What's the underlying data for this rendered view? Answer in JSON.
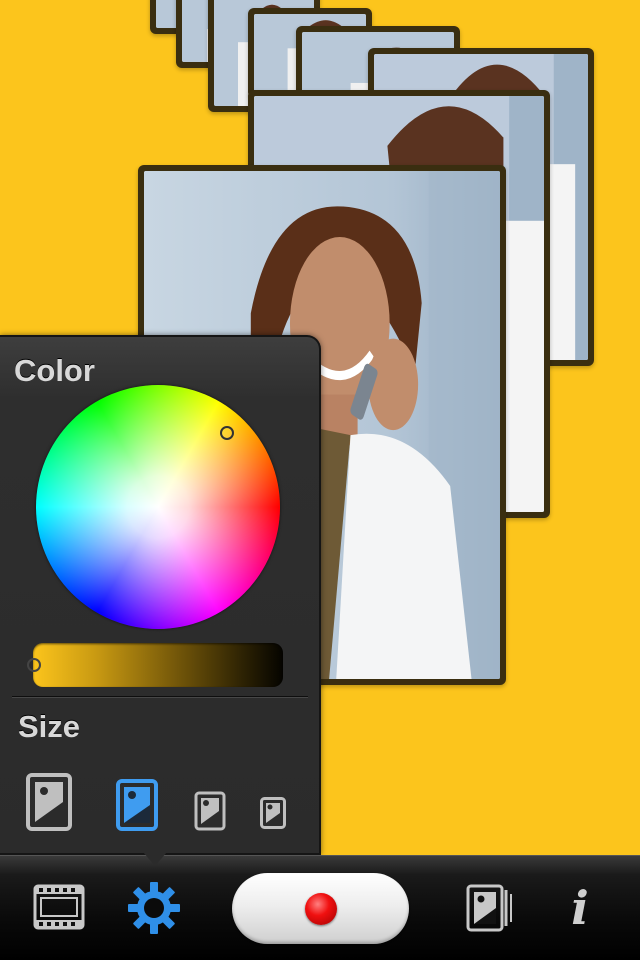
{
  "panel": {
    "color_heading": "Color",
    "size_heading": "Size",
    "selected_size_index": 1,
    "brightness_level": 0.0
  },
  "size_options": [
    {
      "icon": "photo-icon",
      "label": "large"
    },
    {
      "icon": "photo-icon",
      "label": "medium"
    },
    {
      "icon": "photo-icon",
      "label": "small"
    },
    {
      "icon": "photo-icon",
      "label": "extra-small"
    }
  ],
  "toolbar": {
    "filmstrip_icon": "filmstrip-icon",
    "settings_icon": "gear-icon",
    "record_icon": "record-icon",
    "gallery_icon": "photo-gallery-icon",
    "info_icon": "info-icon",
    "info_glyph": "i"
  },
  "colors": {
    "background": "#fcc51c",
    "accent": "#3f9cf0",
    "record": "#f01010",
    "card_frame": "#3a2e10"
  }
}
